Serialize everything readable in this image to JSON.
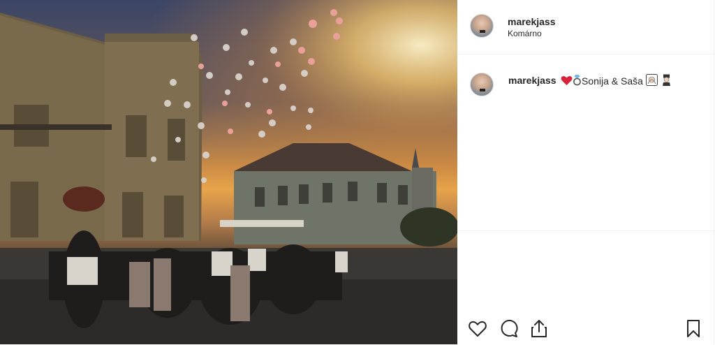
{
  "post": {
    "username": "marekjass",
    "location": "Komárno"
  },
  "comment": {
    "username": "marekjass",
    "caption_text": "Sonija & Saša",
    "emojis": [
      "heart-emoji",
      "ring-emoji",
      "bride-emoji",
      "groom-emoji"
    ]
  },
  "actions": {
    "icons": [
      "heart-icon",
      "comment-icon",
      "share-icon",
      "bookmark-icon"
    ]
  },
  "photo": {
    "description_icon": "photo-balloons-sunset"
  }
}
